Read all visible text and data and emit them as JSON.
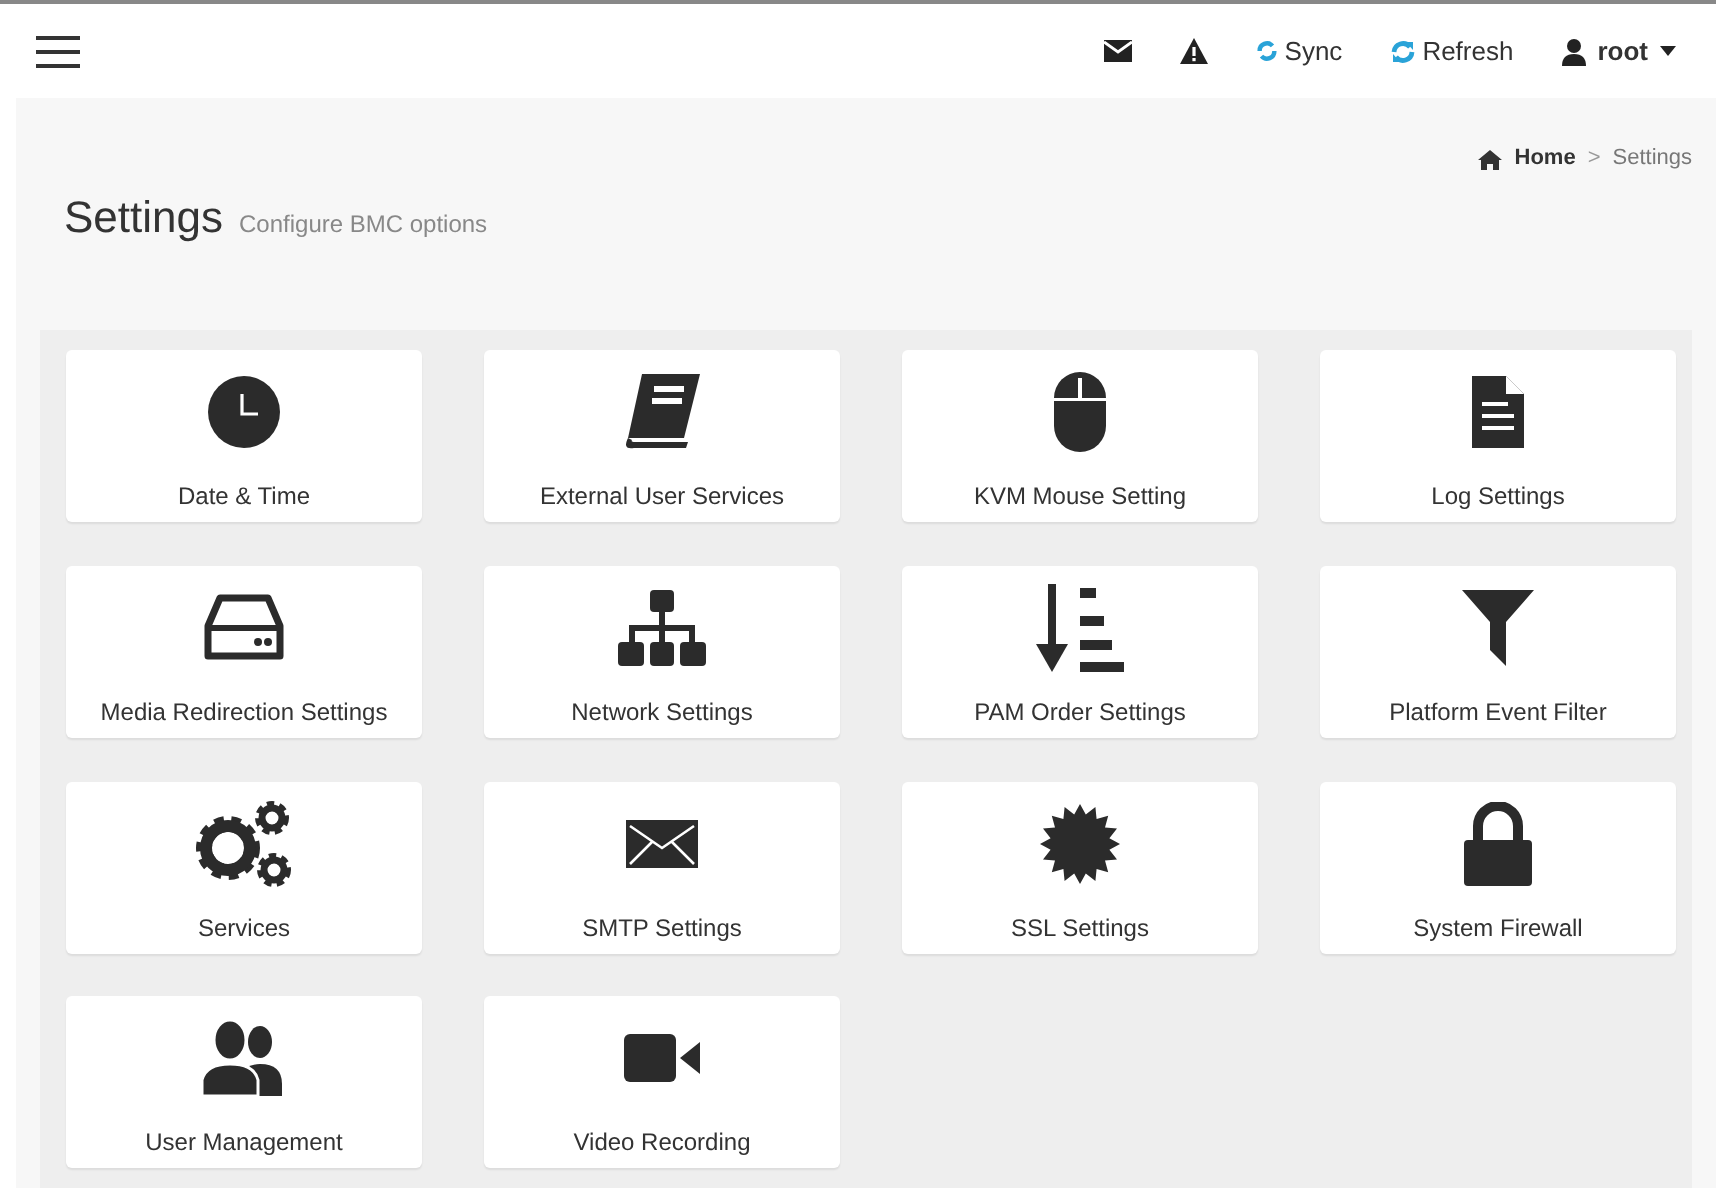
{
  "topbar": {
    "sync": "Sync",
    "refresh": "Refresh",
    "user": "root"
  },
  "header": {
    "title": "Settings",
    "subtitle": "Configure BMC options"
  },
  "breadcrumb": [
    "Home",
    "Settings"
  ],
  "breadcrumb_separator": ">",
  "tiles": [
    {
      "label": "Date & Time"
    },
    {
      "label": "External User Services"
    },
    {
      "label": "KVM Mouse Setting"
    },
    {
      "label": "Log Settings"
    },
    {
      "label": "Media Redirection Settings"
    },
    {
      "label": "Network Settings"
    },
    {
      "label": "PAM Order Settings"
    },
    {
      "label": "Platform Event Filter"
    },
    {
      "label": "Services"
    },
    {
      "label": "SMTP Settings"
    },
    {
      "label": "SSL Settings"
    },
    {
      "label": "System Firewall"
    },
    {
      "label": "User Management"
    },
    {
      "label": "Video Recording"
    }
  ]
}
